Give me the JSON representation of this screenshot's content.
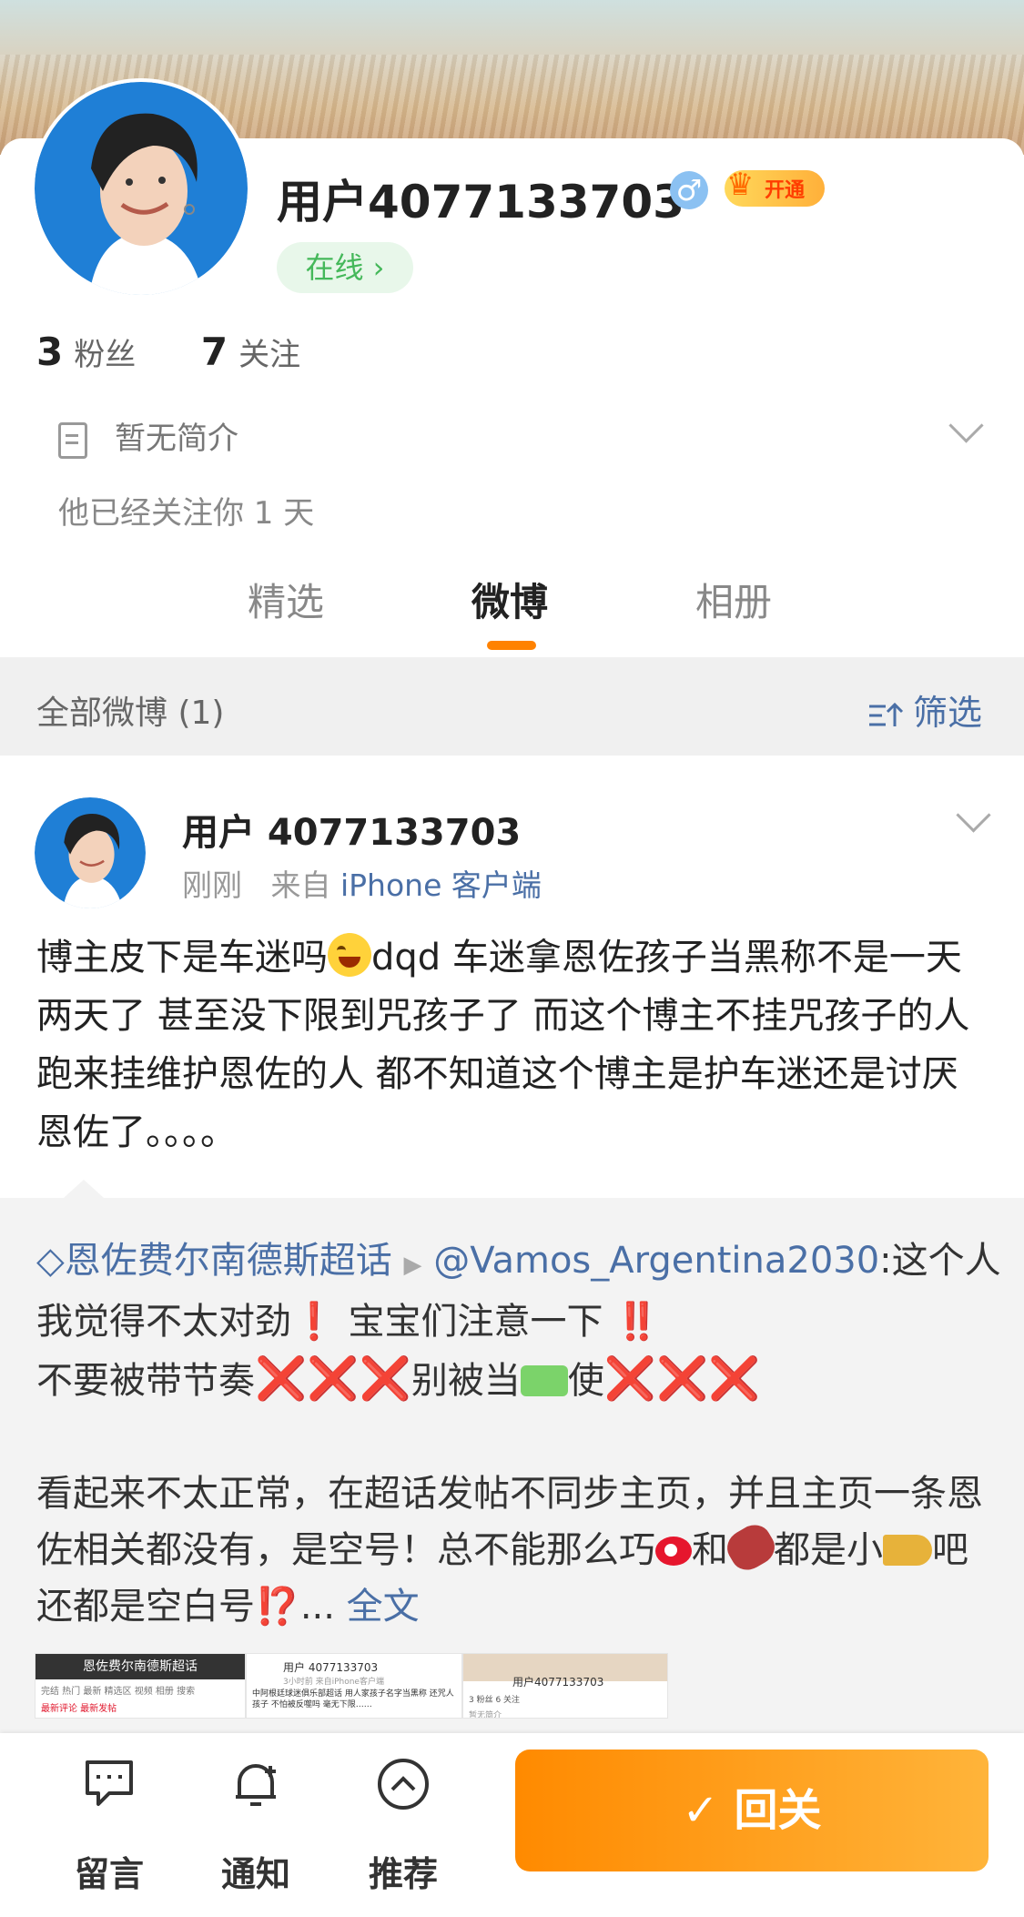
{
  "profile": {
    "username": "用户4077133703",
    "gender_symbol": "♂",
    "vip_badge": "开通",
    "online_label": "在线 ›",
    "fans_count": "3",
    "fans_label": "粉丝",
    "following_count": "7",
    "following_label": "关注",
    "bio": "暂无简介",
    "follow_info": "他已经关注你 1 天"
  },
  "tabs": [
    {
      "label": "精选",
      "active": false
    },
    {
      "label": "微博",
      "active": true
    },
    {
      "label": "相册",
      "active": false
    }
  ],
  "filter_bar": {
    "label": "全部微博 (1)",
    "filter_label": "筛选"
  },
  "post": {
    "author": "用户 4077133703",
    "time": "刚刚",
    "source_prefix": "来自",
    "source": "iPhone 客户端",
    "text_part1": "博主皮下是车迷吗",
    "text_part2": "dqd 车迷拿恩佐孩子当黑称不是一天两天了 甚至没下限到咒孩子了 而这个博主不挂咒孩子的人跑来挂维护恩佐的人 都不知道这个博主是护车迷还是讨厌恩佐了。。。。",
    "repost": {
      "topic": "恩佐费尔南德斯超话",
      "mention": "@Vamos_Argentina2030",
      "line1_rest": ":这个人我觉得不太对劲",
      "excl1": "❗",
      "line1_tail": " 宝宝们注意一下 ",
      "excl2": "‼️",
      "line2_a": "不要被带节奏",
      "crosses": "❌❌❌",
      "line2_b": "别被当",
      "line2_c": "使",
      "para2_a": "看起来不太正常，在超话发帖不同步主页，并且主页一条恩佐相关都没有，是空号！总不能那么巧",
      "para2_b": "和",
      "para2_c": "都是小",
      "para2_d": "吧还都是空白号",
      "excl3": "⁉️",
      "ellipsis": "... ",
      "full_text": "全文",
      "thumb1_title": "恩佐费尔南德斯超话",
      "thumb1_tabs": "完结  热门  最新  精选区  视频  相册  搜索",
      "thumb1_sub": "最新评论  最新发帖",
      "thumb2_user": "用户 4077133703",
      "thumb2_meta": "3小时前  来自iPhone客户端",
      "thumb2_text": "中阿根廷球迷俱乐部超话  用人家孩子名字当黑称 还咒人孩子 不怕被反噬吗 毫无下限……",
      "thumb3_user": "用户4077133703",
      "thumb3_stats": "3 粉丝   6 关注",
      "thumb3_bio": "暂无简介"
    }
  },
  "bottom_bar": {
    "message": "留言",
    "notify": "通知",
    "recommend": "推荐",
    "unfollow": "✓ 回关"
  },
  "colors": {
    "accent_orange": "#ff8200",
    "link_blue": "#4a6fa6",
    "online_green": "#45b85a"
  }
}
